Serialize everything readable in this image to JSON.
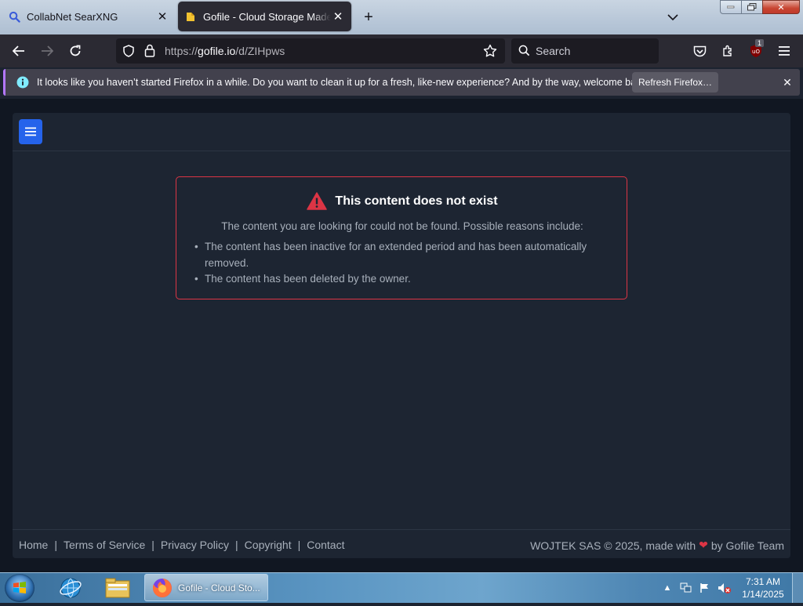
{
  "browser": {
    "tabs": [
      {
        "title": "CollabNet SearXNG",
        "active": false
      },
      {
        "title": "Gofile - Cloud Storage Made Simple",
        "active": true
      }
    ],
    "url_prefix": "https://",
    "url_host": "gofile.io",
    "url_path": "/d/ZIHpws",
    "search_placeholder": "Search",
    "ublock_badge": "1"
  },
  "notification": {
    "message": "It looks like you haven’t started Firefox in a while. Do you want to clean it up for a fresh, like-new experience? And by the way, welcome back!",
    "button": "Refresh Firefox…"
  },
  "error": {
    "title": "This content does not exist",
    "subtitle": "The content you are looking for could not be found. Possible reasons include:",
    "reasons": [
      "The content has been inactive for an extended period and has been automatically removed.",
      "The content has been deleted by the owner."
    ]
  },
  "footer": {
    "links": [
      "Home",
      "Terms of Service",
      "Privacy Policy",
      "Copyright",
      "Contact"
    ],
    "copyright_prefix": "WOJTEK SAS © 2025, made with",
    "copyright_suffix": "by Gofile Team"
  },
  "taskbar": {
    "task_label": "Gofile - Cloud Sto...",
    "time": "7:31 AM",
    "date": "1/14/2025"
  },
  "colors": {
    "page_bg": "#111722",
    "panel_bg": "#1d2532",
    "accent": "#2563eb",
    "error_border": "#dc3545"
  }
}
